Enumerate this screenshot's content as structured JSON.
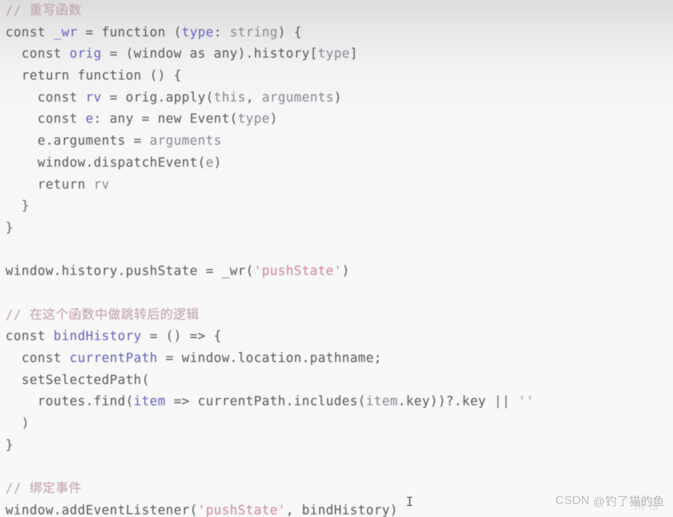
{
  "editor": {
    "language": "TypeScript",
    "background_color": "#f7f7f7",
    "colors": {
      "comment": "#c9a8ae",
      "declaration": "#6b6bc8",
      "string": "#d98c9e",
      "plain": "#5f6066",
      "dim": "#8e8e9c"
    },
    "caret": "I",
    "lines": [
      {
        "id": "l1",
        "tokens": [
          {
            "text": "// 重写函数",
            "kind": "comment"
          }
        ]
      },
      {
        "id": "l2",
        "tokens": [
          {
            "text": "const ",
            "kind": "kw"
          },
          {
            "text": "_wr",
            "kind": "decl"
          },
          {
            "text": " = function (",
            "kind": "plain"
          },
          {
            "text": "type",
            "kind": "decl"
          },
          {
            "text": ": ",
            "kind": "plain"
          },
          {
            "text": "string",
            "kind": "dim"
          },
          {
            "text": ") {",
            "kind": "plain"
          }
        ]
      },
      {
        "id": "l3",
        "tokens": [
          {
            "text": "  const ",
            "kind": "kw"
          },
          {
            "text": "orig",
            "kind": "decl"
          },
          {
            "text": " = (window as any).history[",
            "kind": "plain"
          },
          {
            "text": "type",
            "kind": "dim"
          },
          {
            "text": "]",
            "kind": "plain"
          }
        ]
      },
      {
        "id": "l4",
        "tokens": [
          {
            "text": "  return function () {",
            "kind": "plain"
          }
        ]
      },
      {
        "id": "l5",
        "tokens": [
          {
            "text": "    const ",
            "kind": "kw"
          },
          {
            "text": "rv",
            "kind": "decl"
          },
          {
            "text": " = orig.apply(",
            "kind": "plain"
          },
          {
            "text": "this",
            "kind": "dim"
          },
          {
            "text": ", ",
            "kind": "plain"
          },
          {
            "text": "arguments",
            "kind": "dim"
          },
          {
            "text": ")",
            "kind": "plain"
          }
        ]
      },
      {
        "id": "l6",
        "tokens": [
          {
            "text": "    const ",
            "kind": "kw"
          },
          {
            "text": "e",
            "kind": "decl"
          },
          {
            "text": ": any = new Event(",
            "kind": "plain"
          },
          {
            "text": "type",
            "kind": "dim"
          },
          {
            "text": ")",
            "kind": "plain"
          }
        ]
      },
      {
        "id": "l7",
        "tokens": [
          {
            "text": "    e.arguments = ",
            "kind": "plain"
          },
          {
            "text": "arguments",
            "kind": "dim"
          }
        ]
      },
      {
        "id": "l8",
        "tokens": [
          {
            "text": "    window.dispatchEvent(",
            "kind": "plain"
          },
          {
            "text": "e",
            "kind": "dim"
          },
          {
            "text": ")",
            "kind": "plain"
          }
        ]
      },
      {
        "id": "l9",
        "tokens": [
          {
            "text": "    return ",
            "kind": "kw"
          },
          {
            "text": "rv",
            "kind": "dim"
          }
        ]
      },
      {
        "id": "l10",
        "tokens": [
          {
            "text": "  }",
            "kind": "punct"
          }
        ]
      },
      {
        "id": "l11",
        "tokens": [
          {
            "text": "}",
            "kind": "punct"
          }
        ]
      },
      {
        "id": "l12",
        "tokens": [
          {
            "text": "",
            "kind": "plain"
          }
        ]
      },
      {
        "id": "l13",
        "tokens": [
          {
            "text": "window.history.pushState = _wr(",
            "kind": "plain"
          },
          {
            "text": "'pushState'",
            "kind": "str"
          },
          {
            "text": ")",
            "kind": "plain"
          }
        ]
      },
      {
        "id": "l14",
        "tokens": [
          {
            "text": "",
            "kind": "plain"
          }
        ]
      },
      {
        "id": "l15",
        "tokens": [
          {
            "text": "// 在这个函数中做跳转后的逻辑",
            "kind": "comment"
          }
        ]
      },
      {
        "id": "l16",
        "tokens": [
          {
            "text": "const ",
            "kind": "kw"
          },
          {
            "text": "bindHistory",
            "kind": "decl"
          },
          {
            "text": " = () => {",
            "kind": "plain"
          }
        ]
      },
      {
        "id": "l17",
        "tokens": [
          {
            "text": "  const ",
            "kind": "kw"
          },
          {
            "text": "currentPath",
            "kind": "decl"
          },
          {
            "text": " = window.location.pathname;",
            "kind": "plain"
          }
        ]
      },
      {
        "id": "l18",
        "tokens": [
          {
            "text": "  setSelectedPath(",
            "kind": "plain"
          }
        ]
      },
      {
        "id": "l19",
        "tokens": [
          {
            "text": "    routes.find(",
            "kind": "plain"
          },
          {
            "text": "item",
            "kind": "decl"
          },
          {
            "text": " => currentPath.includes(",
            "kind": "plain"
          },
          {
            "text": "item",
            "kind": "dim"
          },
          {
            "text": ".key))?.key ",
            "kind": "plain"
          },
          {
            "text": "|| ",
            "kind": "op"
          },
          {
            "text": "''",
            "kind": "str"
          }
        ]
      },
      {
        "id": "l20",
        "tokens": [
          {
            "text": "  )",
            "kind": "punct"
          }
        ]
      },
      {
        "id": "l21",
        "tokens": [
          {
            "text": "}",
            "kind": "punct"
          }
        ]
      },
      {
        "id": "l22",
        "tokens": [
          {
            "text": "",
            "kind": "plain"
          }
        ]
      },
      {
        "id": "l23",
        "tokens": [
          {
            "text": "// 绑定事件",
            "kind": "comment"
          }
        ]
      },
      {
        "id": "l24",
        "tokens": [
          {
            "text": "window.addEventListener(",
            "kind": "plain"
          },
          {
            "text": "'pushState'",
            "kind": "str"
          },
          {
            "text": ", bindHistory)",
            "kind": "plain"
          }
        ]
      }
    ]
  },
  "watermark": {
    "brand": "CSDN",
    "username": "@钓了猫的鱼",
    "ghost": "博客"
  }
}
